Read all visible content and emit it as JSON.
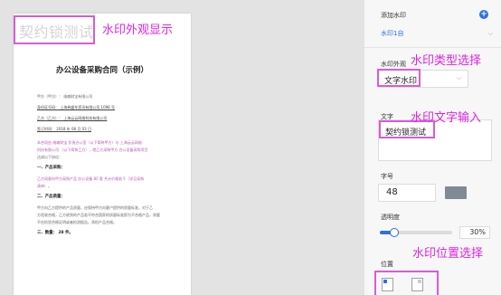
{
  "document": {
    "watermark_text": "契约锁测试",
    "title": "办公设备采购合同（示例）",
    "lines": [
      {
        "text": "甲方（甲方）：  维森财宝有限公司",
        "cls": ""
      },
      {
        "text": "身份证号码：  上海券盛车资讯有限公司 1098 号",
        "cls": "ul"
      },
      {
        "text": "乙方（乙方）：  上海云云网络科技有限公司",
        "cls": "ul"
      },
      {
        "text": "签订时间：  2018 年 08 月 03 日",
        "cls": "ul"
      },
      {
        "text": "本合同由  维森财宝  负责办公室（以下简称甲方）与  上海云云网络",
        "cls": "purple"
      },
      {
        "text": "科技有限公司  （以下简称乙方），就乙方采购甲方  办公设备采购项目",
        "cls": "purple"
      },
      {
        "text": "达成以下协议：",
        "cls": ""
      },
      {
        "text": "一、产品采购：",
        "cls": "bold"
      },
      {
        "text": "乙方同意向甲方采购产品  办公设备 80 套  共计价格若干（详见采购",
        "cls": "purple"
      },
      {
        "text": "清单）。",
        "cls": "purple"
      },
      {
        "text": "二、产品质量：",
        "cls": "bold"
      },
      {
        "text": "甲方向乙方提供的产品质量，应保持甲方向客户提供的质量标准，对于乙",
        "cls": ""
      },
      {
        "text": "方验收合格，乙方收到的产品若不符合国家的质量标准即为不合格产品，则要",
        "cls": ""
      },
      {
        "text": "不在检验合格证明或者检测报告。承担产品合格。",
        "cls": ""
      },
      {
        "text": "三、数量：  28    件。",
        "cls": "bold"
      }
    ]
  },
  "annotations": {
    "appearance_display": "水印外观显示",
    "type_select": "水印类型选择",
    "text_input": "水印文字输入",
    "position_select": "水印位置选择"
  },
  "panel": {
    "add_watermark_label": "添加水印",
    "watermark_item": "水印1自",
    "appearance_label": "水印外观",
    "type_value": "文字水印",
    "text_label": "文字",
    "text_value": "契约锁测试",
    "font_size_label": "字号",
    "font_size_value": "48",
    "color_value": "#808a94",
    "opacity_label": "透明度",
    "opacity_value": "30%",
    "opacity_fraction": 0.2,
    "position_label": "位置",
    "position_selected": "top-left"
  },
  "colors": {
    "accent": "#2f6fe4",
    "annotation": "#e223e2"
  }
}
